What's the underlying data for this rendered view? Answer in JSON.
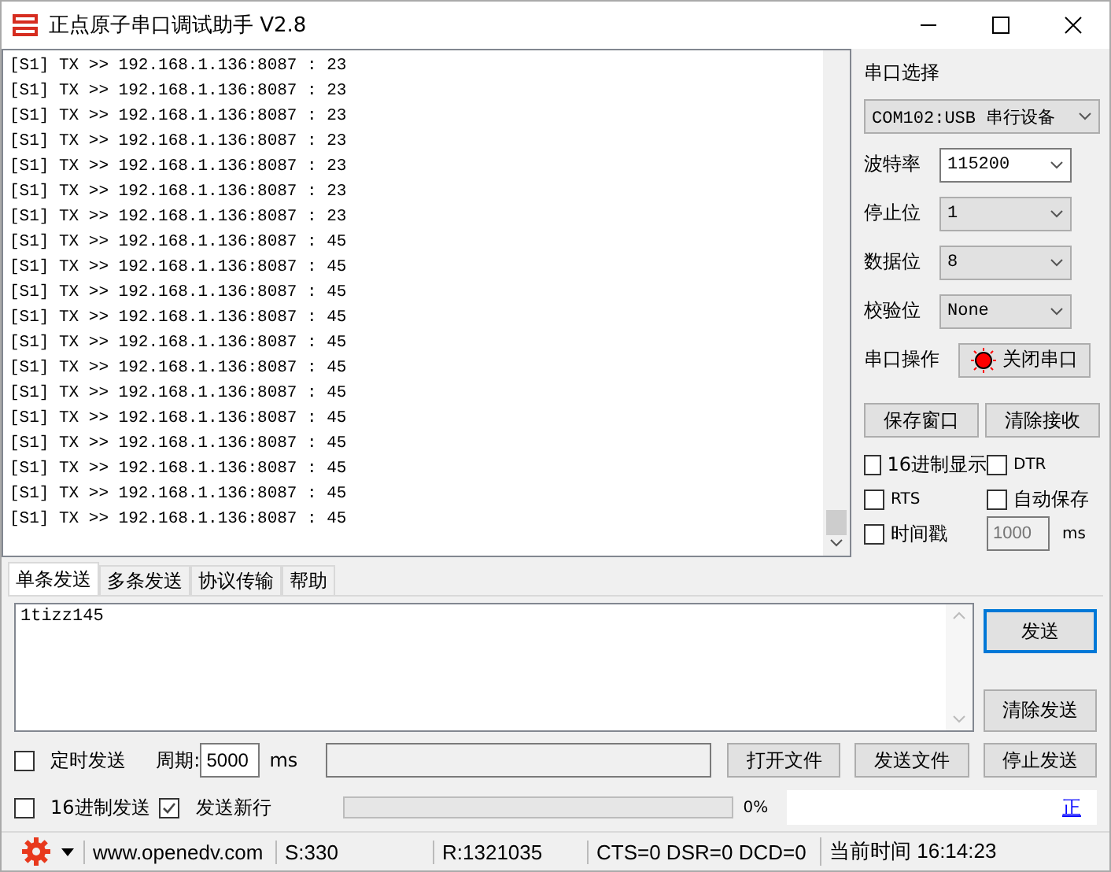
{
  "window": {
    "title": "正点原子串口调试助手 V2.8"
  },
  "log": {
    "lines": [
      "[S1] TX >> 192.168.1.136:8087 : 23",
      "[S1] TX >> 192.168.1.136:8087 : 23",
      "[S1] TX >> 192.168.1.136:8087 : 23",
      "[S1] TX >> 192.168.1.136:8087 : 23",
      "[S1] TX >> 192.168.1.136:8087 : 23",
      "[S1] TX >> 192.168.1.136:8087 : 23",
      "[S1] TX >> 192.168.1.136:8087 : 23",
      "[S1] TX >> 192.168.1.136:8087 : 45",
      "[S1] TX >> 192.168.1.136:8087 : 45",
      "[S1] TX >> 192.168.1.136:8087 : 45",
      "[S1] TX >> 192.168.1.136:8087 : 45",
      "[S1] TX >> 192.168.1.136:8087 : 45",
      "[S1] TX >> 192.168.1.136:8087 : 45",
      "[S1] TX >> 192.168.1.136:8087 : 45",
      "[S1] TX >> 192.168.1.136:8087 : 45",
      "[S1] TX >> 192.168.1.136:8087 : 45",
      "[S1] TX >> 192.168.1.136:8087 : 45",
      "[S1] TX >> 192.168.1.136:8087 : 45",
      "[S1] TX >> 192.168.1.136:8087 : 45"
    ]
  },
  "port": {
    "label": "串口选择",
    "value": "COM102:USB 串行设备"
  },
  "settings": [
    {
      "label": "波特率",
      "value": "115200",
      "editable": true
    },
    {
      "label": "停止位",
      "value": "1",
      "editable": false
    },
    {
      "label": "数据位",
      "value": "8",
      "editable": false
    },
    {
      "label": "校验位",
      "value": "None",
      "editable": false
    }
  ],
  "port_operation": {
    "label": "串口操作",
    "button": "关闭串口",
    "open": true
  },
  "receive_buttons": [
    "保存窗口",
    "清除接收"
  ],
  "receive_options": [
    {
      "label": "16进制显示",
      "checked": false
    },
    {
      "label": "DTR",
      "checked": false
    },
    {
      "label": "RTS",
      "checked": false
    },
    {
      "label": "自动保存",
      "checked": false
    },
    {
      "label": "时间戳",
      "checked": false
    }
  ],
  "timestamp": {
    "placeholder": "1000",
    "unit": "ms"
  },
  "tabs": [
    {
      "label": "单条发送",
      "selected": true
    },
    {
      "label": "多条发送",
      "selected": false
    },
    {
      "label": "协议传输",
      "selected": false
    },
    {
      "label": "帮助",
      "selected": false
    }
  ],
  "send": {
    "text": "1tizz145",
    "send_button": "发送",
    "clear_button": "清除发送"
  },
  "timed_send": {
    "label": "定时发送",
    "checked": false,
    "period_label": "周期:",
    "period": "5000",
    "unit": "ms"
  },
  "hex_send": {
    "label": "16进制发送",
    "checked": false
  },
  "newline": {
    "label": "发送新行",
    "checked": true
  },
  "file_buttons": [
    "打开文件",
    "发送文件",
    "停止发送"
  ],
  "progress": {
    "level": 0,
    "reading": "0%"
  },
  "link": "正",
  "status_bar": {
    "website": "www.openedv.com",
    "sent": "S:330",
    "received": "R:1321035",
    "lines": "CTS=0 DSR=0 DCD=0",
    "time": "当前时间 16:14:23"
  }
}
